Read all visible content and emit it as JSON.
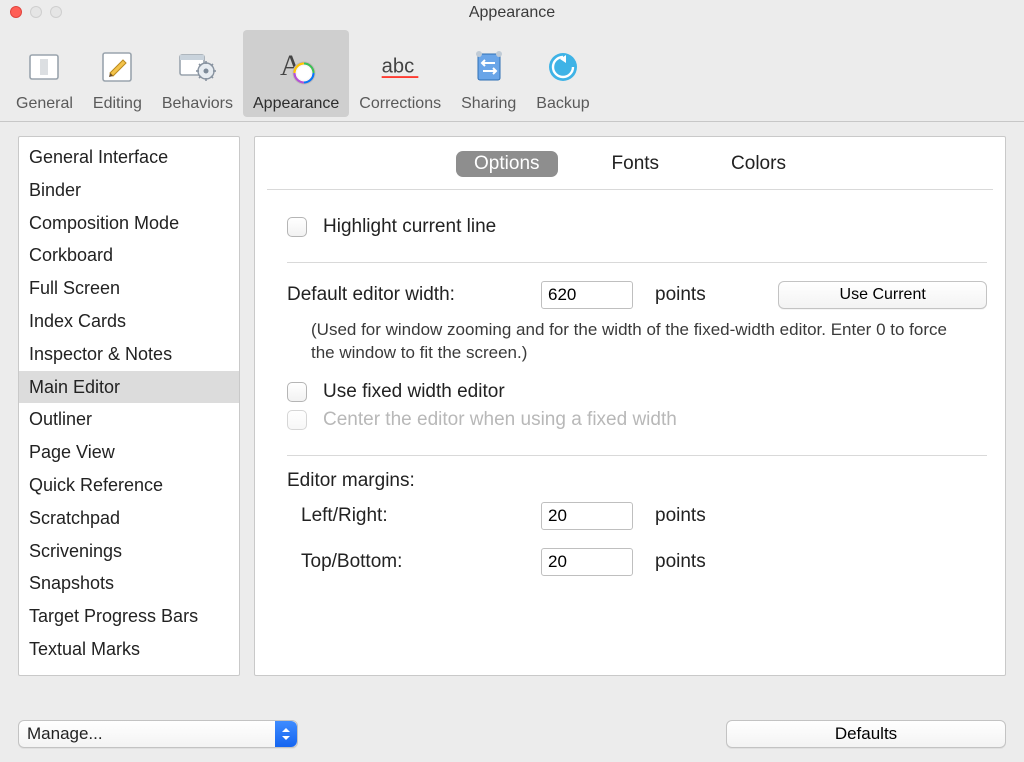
{
  "window": {
    "title": "Appearance"
  },
  "toolbar": {
    "items": [
      {
        "label": "General"
      },
      {
        "label": "Editing"
      },
      {
        "label": "Behaviors"
      },
      {
        "label": "Appearance"
      },
      {
        "label": "Corrections"
      },
      {
        "label": "Sharing"
      },
      {
        "label": "Backup"
      }
    ],
    "selected": "Appearance"
  },
  "sidebar": {
    "items": [
      "General Interface",
      "Binder",
      "Composition Mode",
      "Corkboard",
      "Full Screen",
      "Index Cards",
      "Inspector & Notes",
      "Main Editor",
      "Outliner",
      "Page View",
      "Quick Reference",
      "Scratchpad",
      "Scrivenings",
      "Snapshots",
      "Target Progress Bars",
      "Textual Marks"
    ],
    "selected": "Main Editor"
  },
  "tabs": {
    "items": [
      "Options",
      "Fonts",
      "Colors"
    ],
    "selected": "Options"
  },
  "options": {
    "highlight_line_label": "Highlight current line",
    "default_width_label": "Default editor width:",
    "default_width_value": "620",
    "points_unit": "points",
    "use_current_btn": "Use Current",
    "default_width_note": "(Used for window zooming and for the width of the fixed-width editor. Enter 0 to force the window to fit the screen.)",
    "use_fixed_width_label": "Use fixed width editor",
    "center_fixed_label": "Center the editor when using a fixed width",
    "margins_header": "Editor margins:",
    "left_right_label": "Left/Right:",
    "left_right_value": "20",
    "top_bottom_label": "Top/Bottom:",
    "top_bottom_value": "20"
  },
  "bottom": {
    "manage_label": "Manage...",
    "defaults_label": "Defaults"
  }
}
